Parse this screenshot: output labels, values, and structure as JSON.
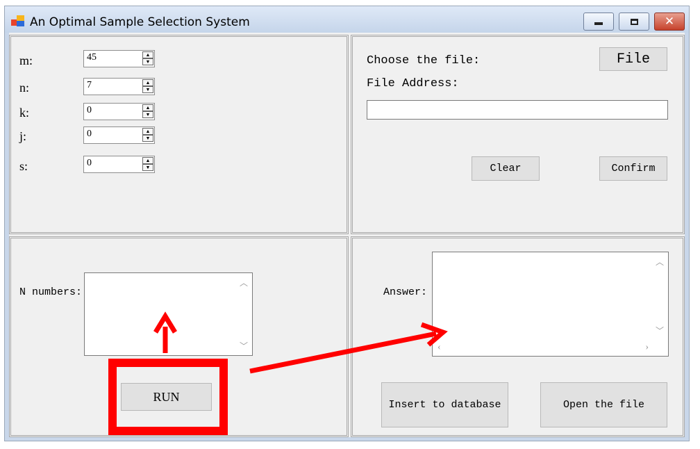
{
  "window": {
    "title": "An Optimal Sample Selection System"
  },
  "params": [
    {
      "label": "m:",
      "value": "45"
    },
    {
      "label": "n:",
      "value": "7"
    },
    {
      "label": "k:",
      "value": "0"
    },
    {
      "label": "j:",
      "value": "0"
    },
    {
      "label": "s:",
      "value": "0"
    }
  ],
  "file_panel": {
    "choose_label": "Choose the file:",
    "file_button": "File",
    "address_label": "File Address:",
    "address_value": "",
    "clear_button": "Clear",
    "confirm_button": "Confirm"
  },
  "numbers_panel": {
    "label": "N numbers:",
    "run_button": "RUN"
  },
  "answer_panel": {
    "label": "Answer:",
    "insert_button": "Insert  to database",
    "open_button": "Open the file"
  },
  "colors": {
    "annotation": "#ff0000",
    "title_bar": "#c5d5ea",
    "close_button": "#c6412b"
  },
  "annotations": [
    "red-box-around-run",
    "arrow-up-to-n-numbers",
    "arrow-to-answer"
  ]
}
